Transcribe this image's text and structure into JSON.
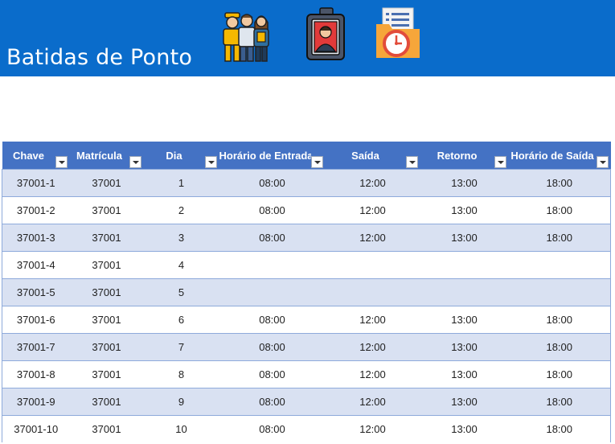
{
  "header": {
    "title": "Batidas de Ponto",
    "background": "#0a6ccb",
    "icons": [
      {
        "name": "team-workers-icon"
      },
      {
        "name": "employee-badge-icon"
      },
      {
        "name": "timesheet-clock-icon"
      }
    ]
  },
  "table": {
    "header_color": "#4472c4",
    "band_color": "#d9e1f2",
    "columns": [
      "Chave",
      "Matrícula",
      "Dia",
      "Horário de Entrada",
      "Saída",
      "Retorno",
      "Horário de Saída"
    ],
    "rows": [
      {
        "chave": "37001-1",
        "matricula": "37001",
        "dia": "1",
        "entrada": "08:00",
        "saida": "12:00",
        "retorno": "13:00",
        "saida_final": "18:00"
      },
      {
        "chave": "37001-2",
        "matricula": "37001",
        "dia": "2",
        "entrada": "08:00",
        "saida": "12:00",
        "retorno": "13:00",
        "saida_final": "18:00"
      },
      {
        "chave": "37001-3",
        "matricula": "37001",
        "dia": "3",
        "entrada": "08:00",
        "saida": "12:00",
        "retorno": "13:00",
        "saida_final": "18:00"
      },
      {
        "chave": "37001-4",
        "matricula": "37001",
        "dia": "4",
        "entrada": "",
        "saida": "",
        "retorno": "",
        "saida_final": ""
      },
      {
        "chave": "37001-5",
        "matricula": "37001",
        "dia": "5",
        "entrada": "",
        "saida": "",
        "retorno": "",
        "saida_final": ""
      },
      {
        "chave": "37001-6",
        "matricula": "37001",
        "dia": "6",
        "entrada": "08:00",
        "saida": "12:00",
        "retorno": "13:00",
        "saida_final": "18:00"
      },
      {
        "chave": "37001-7",
        "matricula": "37001",
        "dia": "7",
        "entrada": "08:00",
        "saida": "12:00",
        "retorno": "13:00",
        "saida_final": "18:00"
      },
      {
        "chave": "37001-8",
        "matricula": "37001",
        "dia": "8",
        "entrada": "08:00",
        "saida": "12:00",
        "retorno": "13:00",
        "saida_final": "18:00"
      },
      {
        "chave": "37001-9",
        "matricula": "37001",
        "dia": "9",
        "entrada": "08:00",
        "saida": "12:00",
        "retorno": "13:00",
        "saida_final": "18:00"
      },
      {
        "chave": "37001-10",
        "matricula": "37001",
        "dia": "10",
        "entrada": "08:00",
        "saida": "12:00",
        "retorno": "13:00",
        "saida_final": "18:00"
      }
    ]
  }
}
